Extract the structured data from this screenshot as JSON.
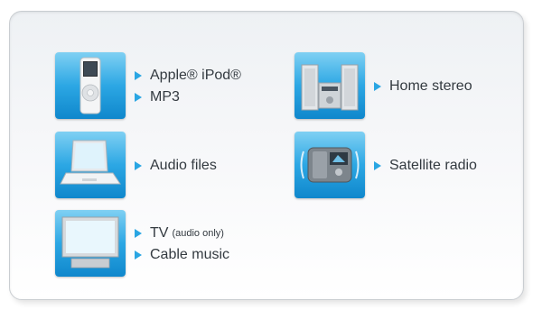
{
  "items": [
    {
      "icon": "ipod-icon",
      "labels": [
        "Apple® iPod®",
        "MP3"
      ]
    },
    {
      "icon": "laptop-icon",
      "labels": [
        "Audio files"
      ]
    },
    {
      "icon": "tv-icon",
      "labels": [
        "TV",
        "Cable music"
      ],
      "note": "(audio only)"
    },
    {
      "icon": "home-stereo-icon",
      "labels": [
        "Home stereo"
      ]
    },
    {
      "icon": "satellite-radio-icon",
      "labels": [
        "Satellite radio"
      ]
    }
  ],
  "colors": {
    "tile_top": "#7fd0f3",
    "tile_bottom": "#0f87cc",
    "arrow": "#2aa6e3",
    "text": "#333a40"
  }
}
